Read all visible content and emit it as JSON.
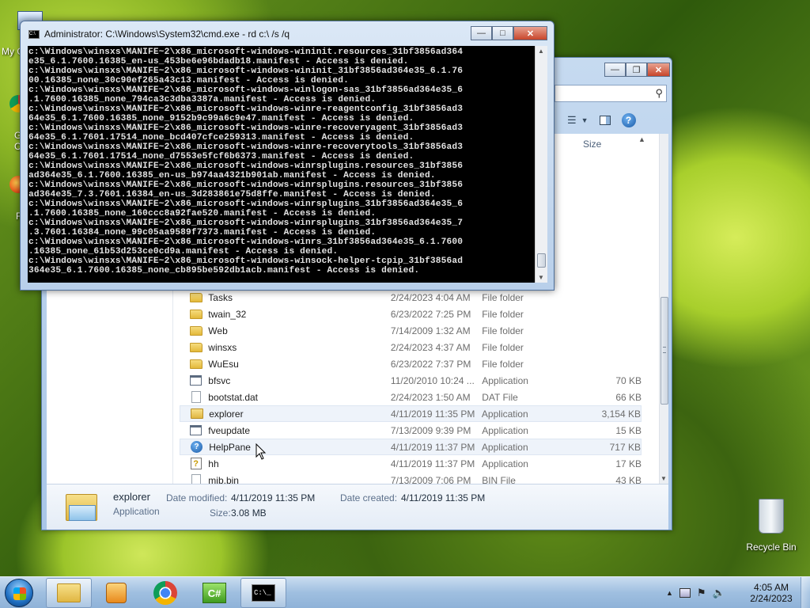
{
  "desktop": {
    "partial_labels": [
      "My C",
      "G",
      "C",
      "F"
    ],
    "recycle_bin_label": "Recycle Bin"
  },
  "cmd": {
    "title": "Administrator: C:\\Windows\\System32\\cmd.exe - rd  c:\\ /s /q",
    "lines": [
      "c:\\Windows\\winsxs\\MANIFE~2\\x86_microsoft-windows-wininit.resources_31bf3856ad364",
      "e35_6.1.7600.16385_en-us_453be6e96bdadb18.manifest - Access is denied.",
      "c:\\Windows\\winsxs\\MANIFE~2\\x86_microsoft-windows-wininit_31bf3856ad364e35_6.1.76",
      "00.16385_none_30c90ef265a43c13.manifest - Access is denied.",
      "c:\\Windows\\winsxs\\MANIFE~2\\x86_microsoft-windows-winlogon-sas_31bf3856ad364e35_6",
      ".1.7600.16385_none_794ca3c3dba3387a.manifest - Access is denied.",
      "c:\\Windows\\winsxs\\MANIFE~2\\x86_microsoft-windows-winre-reagentconfig_31bf3856ad3",
      "64e35_6.1.7600.16385_none_9152b9c99a6c9e47.manifest - Access is denied.",
      "c:\\Windows\\winsxs\\MANIFE~2\\x86_microsoft-windows-winre-recoveryagent_31bf3856ad3",
      "64e35_6.1.7601.17514_none_bcd407cfce259313.manifest - Access is denied.",
      "c:\\Windows\\winsxs\\MANIFE~2\\x86_microsoft-windows-winre-recoverytools_31bf3856ad3",
      "64e35_6.1.7601.17514_none_d7553e5fcf6b6373.manifest - Access is denied.",
      "c:\\Windows\\winsxs\\MANIFE~2\\x86_microsoft-windows-winrsplugins.resources_31bf3856",
      "ad364e35_6.1.7600.16385_en-us_b974aa4321b901ab.manifest - Access is denied.",
      "c:\\Windows\\winsxs\\MANIFE~2\\x86_microsoft-windows-winrsplugins.resources_31bf3856",
      "ad364e35_7.3.7601.16384_en-us_3d283861e75d8ffe.manifest - Access is denied.",
      "c:\\Windows\\winsxs\\MANIFE~2\\x86_microsoft-windows-winrsplugins_31bf3856ad364e35_6",
      ".1.7600.16385_none_160ccc8a92fae520.manifest - Access is denied.",
      "c:\\Windows\\winsxs\\MANIFE~2\\x86_microsoft-windows-winrsplugins_31bf3856ad364e35_7",
      ".3.7601.16384_none_99c05aa9589f7373.manifest - Access is denied.",
      "c:\\Windows\\winsxs\\MANIFE~2\\x86_microsoft-windows-winrs_31bf3856ad364e35_6.1.7600",
      ".16385_none_61b53d253ce0cd9a.manifest - Access is denied.",
      "c:\\Windows\\winsxs\\MANIFE~2\\x86_microsoft-windows-winsock-helper-tcpip_31bf3856ad",
      "364e35_6.1.7600.16385_none_cb895be592db1acb.manifest - Access is denied."
    ]
  },
  "explorer": {
    "column_size_header": "Size",
    "rows": [
      {
        "icon": "folder-icon",
        "name": "Tasks",
        "date": "2/24/2023 4:04 AM",
        "type": "File folder",
        "size": "",
        "hl": false
      },
      {
        "icon": "folder-icon",
        "name": "twain_32",
        "date": "6/23/2022 7:25 PM",
        "type": "File folder",
        "size": "",
        "hl": false
      },
      {
        "icon": "folder-icon",
        "name": "Web",
        "date": "7/14/2009 1:32 AM",
        "type": "File folder",
        "size": "",
        "hl": false
      },
      {
        "icon": "folder-icon",
        "name": "winsxs",
        "date": "2/24/2023 4:37 AM",
        "type": "File folder",
        "size": "",
        "hl": false
      },
      {
        "icon": "folder-icon",
        "name": "WuEsu",
        "date": "6/23/2022 7:37 PM",
        "type": "File folder",
        "size": "",
        "hl": false
      },
      {
        "icon": "app-icon",
        "name": "bfsvc",
        "date": "11/20/2010 10:24 ...",
        "type": "Application",
        "size": "70 KB",
        "hl": false
      },
      {
        "icon": "file-icon",
        "name": "bootstat.dat",
        "date": "2/24/2023 1:50 AM",
        "type": "DAT File",
        "size": "66 KB",
        "hl": false
      },
      {
        "icon": "explorer-icon",
        "name": "explorer",
        "date": "4/11/2019 11:35 PM",
        "type": "Application",
        "size": "3,154 KB",
        "hl": true
      },
      {
        "icon": "app-icon",
        "name": "fveupdate",
        "date": "7/13/2009 9:39 PM",
        "type": "Application",
        "size": "15 KB",
        "hl": false
      },
      {
        "icon": "help-icon",
        "name": "HelpPane",
        "date": "4/11/2019 11:37 PM",
        "type": "Application",
        "size": "717 KB",
        "hl": true
      },
      {
        "icon": "hh-icon",
        "name": "hh",
        "date": "4/11/2019 11:37 PM",
        "type": "Application",
        "size": "17 KB",
        "hl": false
      },
      {
        "icon": "file-icon",
        "name": "mib.bin",
        "date": "7/13/2009 7:06 PM",
        "type": "BIN File",
        "size": "43 KB",
        "hl": false
      }
    ],
    "details": {
      "name": "explorer",
      "type": "Application",
      "date_modified_label": "Date modified:",
      "date_modified": "4/11/2019 11:35 PM",
      "date_created_label": "Date created:",
      "date_created": "4/11/2019 11:35 PM",
      "size_label": "Size:",
      "size": "3.08 MB"
    }
  },
  "taskbar": {
    "time": "4:05 AM",
    "date": "2/24/2023"
  },
  "colors": {
    "console_bg": "#000000",
    "console_fg": "#e2e2e2",
    "selection_hl": "#eef3fa"
  }
}
